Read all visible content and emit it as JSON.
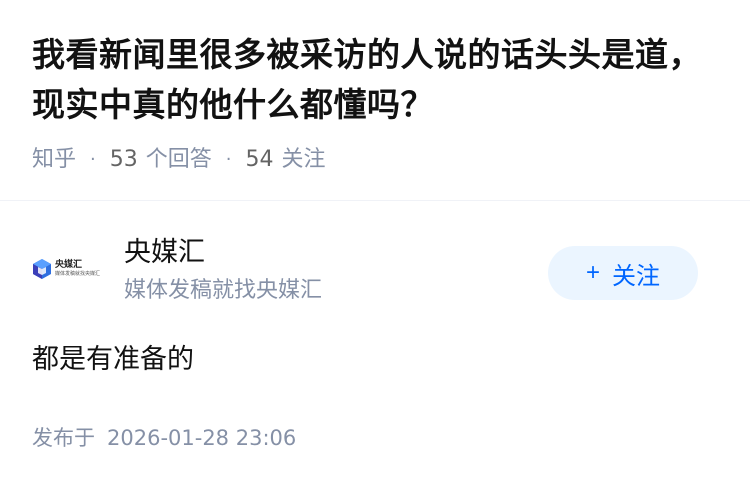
{
  "question": {
    "title": "我看新闻里很多被采访的人说的话头头是道，现实中真的他什么都懂吗？"
  },
  "meta": {
    "source": "知乎",
    "answers_count": "53",
    "answers_label": "个回答",
    "followers_count": "54",
    "followers_label": "关注"
  },
  "author": {
    "avatar_main_text": "央媒汇",
    "avatar_sub_text": "媒体发稿就找央媒汇",
    "name": "央媒汇",
    "bio": "媒体发稿就找央媒汇",
    "follow_icon": "plus-icon",
    "follow_plus": "+",
    "follow_label": "关注"
  },
  "answer": {
    "content": "都是有准备的",
    "publish_label": "发布于",
    "publish_time": "2026-01-28 23:06"
  },
  "colors": {
    "title": "#121212",
    "meta": "#8590a6",
    "accent": "#0066ff",
    "follow_bg": "#ebf5ff"
  }
}
